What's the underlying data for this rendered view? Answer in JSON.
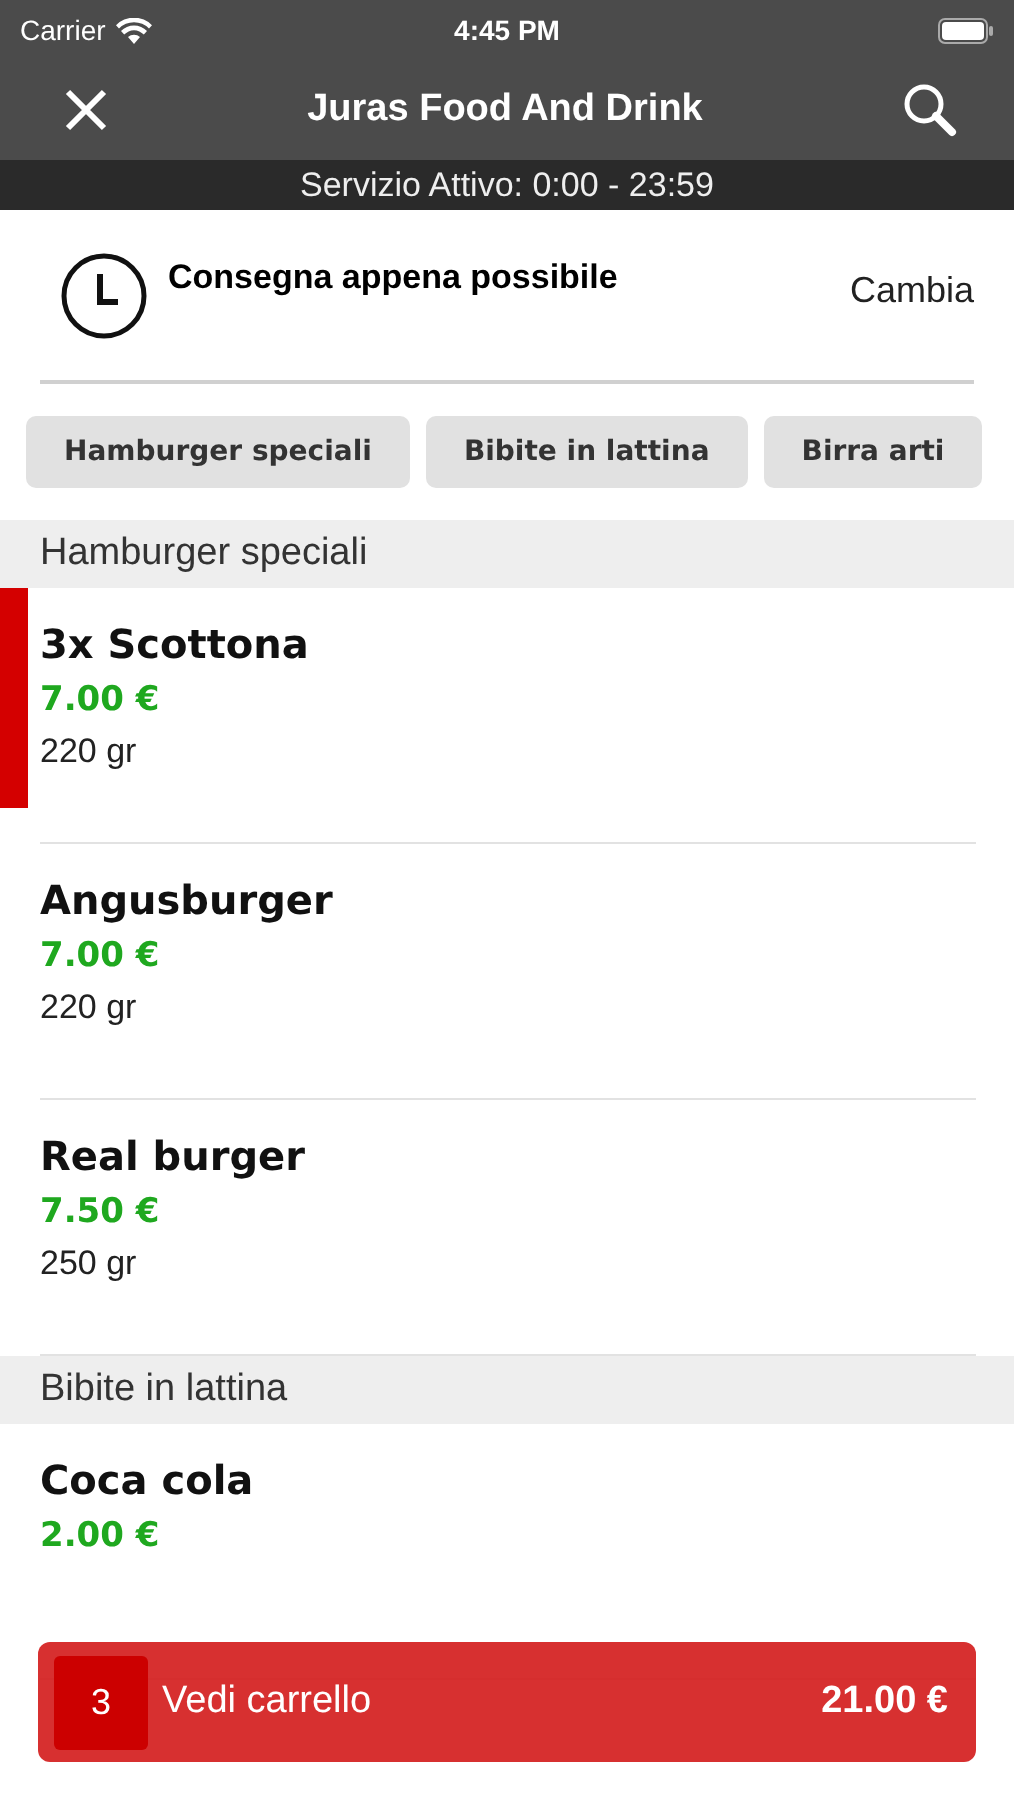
{
  "status_bar": {
    "carrier": "Carrier",
    "time": "4:45 PM"
  },
  "nav": {
    "title": "Juras Food And Drink"
  },
  "service": "Servizio Attivo: 0:00 - 23:59",
  "delivery": {
    "label": "Consegna appena possibile",
    "action": "Cambia"
  },
  "categories": [
    {
      "label": "Hamburger speciali",
      "selected": false
    },
    {
      "label": "Bibite in lattina",
      "selected": false
    },
    {
      "label": "Birra arti",
      "selected": false
    }
  ],
  "sections": [
    {
      "title": "Hamburger speciali",
      "items": [
        {
          "name": "3x Scottona",
          "price": "7.00 €",
          "note": "220 gr",
          "in_cart": true
        },
        {
          "name": "Angusburger",
          "price": "7.00 €",
          "note": "220 gr",
          "in_cart": false
        },
        {
          "name": "Real burger",
          "price": "7.50 €",
          "note": "250 gr",
          "in_cart": false
        }
      ]
    },
    {
      "title": "Bibite in lattina",
      "items": [
        {
          "name": "Coca cola",
          "price": "2.00 €",
          "in_cart": false
        }
      ]
    }
  ],
  "cart": {
    "count": "3",
    "label": "Vedi carrello",
    "total": "21.00 €"
  }
}
